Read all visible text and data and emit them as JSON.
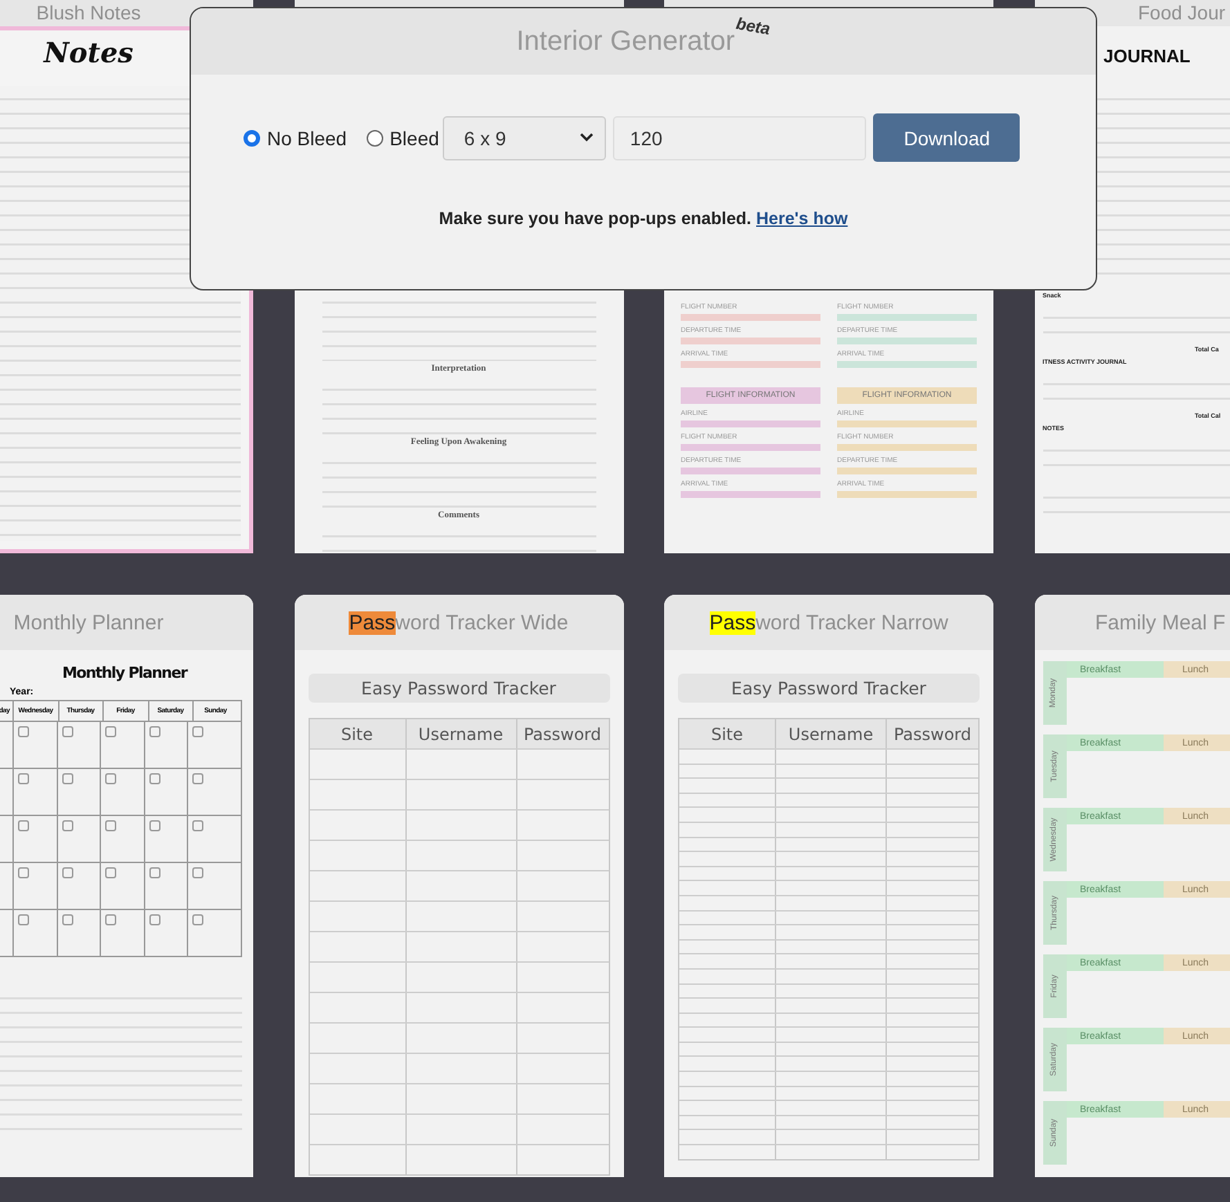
{
  "cards": [
    {
      "title": "Blush Notes",
      "preview": {
        "kind": "notes",
        "heading": "Notes"
      }
    },
    {
      "preview": {
        "kind": "dream",
        "labels": [
          "Interpretation",
          "Feeling Upon Awakening",
          "Comments"
        ]
      }
    },
    {
      "preview": {
        "kind": "flight",
        "blocks": [
          {
            "color": "#efcfcd",
            "labels": [
              "FLIGHT NUMBER",
              "DEPARTURE TIME",
              "ARRIVAL TIME"
            ]
          },
          {
            "color": "#cbe5da",
            "labels": [
              "FLIGHT NUMBER",
              "DEPARTURE TIME",
              "ARRIVAL TIME"
            ]
          },
          {
            "color": "#e6c6df",
            "heading": "FLIGHT INFORMATION",
            "labels": [
              "AIRLINE",
              "FLIGHT NUMBER",
              "DEPARTURE TIME",
              "ARRIVAL TIME"
            ]
          },
          {
            "color": "#eedcb9",
            "heading": "FLIGHT INFORMATION",
            "labels": [
              "AIRLINE",
              "FLIGHT NUMBER",
              "DEPARTURE TIME",
              "ARRIVAL TIME"
            ]
          }
        ]
      }
    },
    {
      "title": "Food Jour",
      "preview": {
        "kind": "food",
        "heading": "JOURNAL",
        "sections": [
          {
            "label": "Snack",
            "total": "Total Ca"
          },
          {
            "label": "ITNESS ACTIVITY JOURNAL",
            "total": "Total Cal"
          },
          {
            "label": "NOTES"
          }
        ]
      }
    },
    {
      "title": "Monthly Planner",
      "preview": {
        "kind": "monthly",
        "heading": "Monthly Planner",
        "year_label": "Year:",
        "days": [
          "day",
          "Wednesday",
          "Thursday",
          "Friday",
          "Saturday",
          "Sunday"
        ]
      }
    },
    {
      "highlight": {
        "text": "Pass",
        "color": "#ee8a3a"
      },
      "title_rest": "word Tracker Wide",
      "preview": {
        "kind": "password",
        "dense_rows": false,
        "heading": "Easy Password Tracker",
        "columns": [
          "Site",
          "Username",
          "Password"
        ]
      }
    },
    {
      "highlight": {
        "text": "Pass",
        "color": "#ffff00"
      },
      "title_rest": "word Tracker Narrow",
      "preview": {
        "kind": "password",
        "dense_rows": true,
        "heading": "Easy Password Tracker",
        "columns": [
          "Site",
          "Username",
          "Password"
        ]
      }
    },
    {
      "title": "Family Meal F",
      "preview": {
        "kind": "meal",
        "days": [
          {
            "day": "Monday",
            "meals": [
              "Breakfast",
              "Lunch"
            ]
          },
          {
            "day": "Tuesday",
            "meals": [
              "Breakfast",
              "Lunch"
            ]
          },
          {
            "day": "Wednesday",
            "meals": [
              "Breakfast",
              "Lunch"
            ]
          },
          {
            "day": "Thursday",
            "meals": [
              "Breakfast",
              "Lunch"
            ]
          },
          {
            "day": "Friday",
            "meals": [
              "Breakfast",
              "Lunch"
            ]
          },
          {
            "day": "Saturday",
            "meals": [
              "Breakfast",
              "Lunch"
            ]
          },
          {
            "day": "Sunday",
            "meals": [
              "Breakfast",
              "Lunch"
            ]
          }
        ]
      }
    }
  ],
  "dialog": {
    "title": "Interior Generator",
    "badge": "beta",
    "options": [
      {
        "label": "No Bleed",
        "selected": true
      },
      {
        "label": "Bleed",
        "selected": false
      }
    ],
    "size": "6 x 9",
    "pages": "120",
    "button": "Download",
    "note": "Make sure you have pop-ups enabled.",
    "link": "Here's how"
  }
}
